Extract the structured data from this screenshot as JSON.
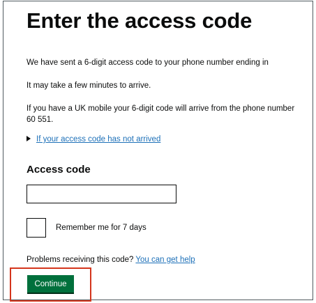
{
  "page": {
    "title": "Enter the access code",
    "paragraphs": [
      "We have sent a 6-digit access code to your phone number ending in",
      "It may take a few minutes to arrive.",
      "If you have a UK mobile your 6-digit code will arrive from the phone number",
      "60 551."
    ]
  },
  "details": {
    "summary": "If your access code has not arrived",
    "icon": "triangle-right-icon"
  },
  "form": {
    "field_label": "Access code",
    "field_value": "",
    "checkbox_label": "Remember me for 7 days",
    "checkbox_checked": false
  },
  "help": {
    "prefix": "Problems receiving this code?",
    "link": "You can get help"
  },
  "actions": {
    "continue_label": "Continue"
  },
  "colors": {
    "text": "#0b0c0c",
    "link": "#1d70b8",
    "button": "#00703c",
    "highlight": "#d4351c"
  }
}
